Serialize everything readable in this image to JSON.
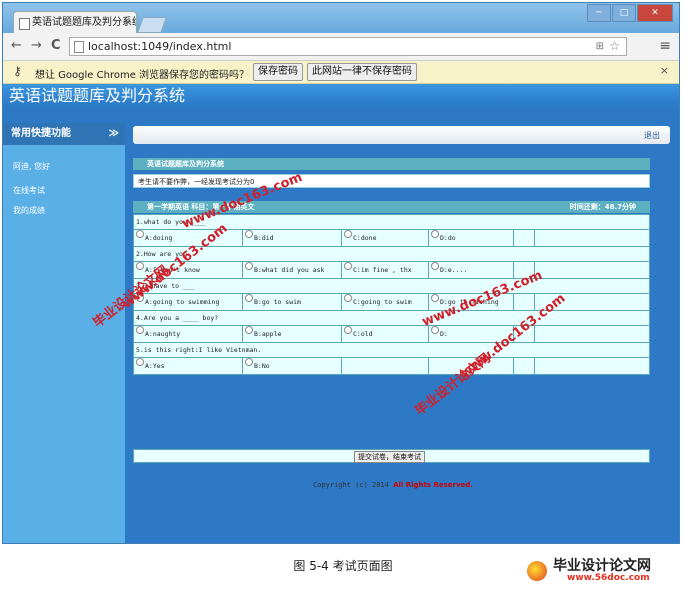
{
  "browser": {
    "tab_title": "英语试题题库及判分系统",
    "tab_close": "×",
    "url": "localhost:1049/index.html",
    "window_buttons": [
      "─",
      "□",
      "✕"
    ],
    "nav": {
      "back": "←",
      "forward": "→",
      "reload": "C"
    },
    "menu": "≡"
  },
  "infobar": {
    "message": "想让 Google Chrome 浏览器保存您的密码吗？",
    "save_label": "保存密码",
    "never_label": "此网站一律不保存密码",
    "close": "×"
  },
  "app": {
    "title": "英语试题题库及判分系统",
    "logout": "退出",
    "sidebar": {
      "header": "常用快捷功能",
      "chevron": "≫",
      "items": [
        "阿迪, 您好",
        "在线考试",
        "我的成绩"
      ]
    },
    "exam": {
      "panel_title": "英语试题题库及判分系统",
      "notice": "考生请不要作弊，一经发现考试分为0",
      "paper_title": "第一学期英语  科目：第一学期英文",
      "timer": "时间还剩：48.7分钟",
      "questions": [
        {
          "text": "1.what do you ____",
          "options": [
            "A:doing",
            "B:did",
            "C:done",
            "D:do"
          ]
        },
        {
          "text": "2.How are you",
          "options": [
            "A:I don't know",
            "B:what did you ask",
            "C:im fine , thx",
            "D:e...."
          ]
        },
        {
          "text": "3.I have to ___",
          "options": [
            "A:going to swimming",
            "B:go to swim",
            "C:going to swim",
            "D:go to fishing"
          ]
        },
        {
          "text": "4.Are you a ____ boy?",
          "options": [
            "A:naughty",
            "B:apple",
            "C:old",
            "D:"
          ]
        },
        {
          "text": "5.is this right:I like Vietnman.",
          "options": [
            "A:Yes",
            "B:No"
          ]
        }
      ],
      "submit_label": "提交试卷，结束考试"
    },
    "copyright_text": "Copyright (c) 2014",
    "copyright_bold": "All Rights Reserved."
  },
  "watermarks": [
    "毕业设计论文网",
    "www.doc163.com",
    "毕业设计论文网",
    "www.doc163.com",
    "毕业设计论文网",
    "www.doc163.com"
  ],
  "caption": "图 5-4  考试页面图",
  "brand": {
    "name": "毕业设计论文网",
    "url": "www.56doc.com"
  }
}
